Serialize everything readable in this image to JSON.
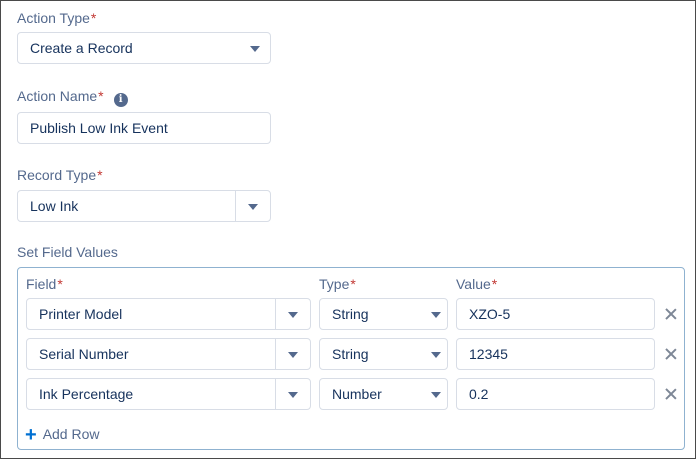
{
  "form": {
    "action_type": {
      "label": "Action Type",
      "required_mark": "*",
      "value": "Create a Record"
    },
    "action_name": {
      "label": "Action Name",
      "required_mark": "*",
      "info_icon": "i",
      "value": "Publish Low Ink Event"
    },
    "record_type": {
      "label": "Record Type",
      "required_mark": "*",
      "value": "Low Ink"
    },
    "set_field_values": {
      "label": "Set Field Values",
      "columns": {
        "field": "Field",
        "type": "Type",
        "value": "Value",
        "required_mark": "*"
      },
      "rows": [
        {
          "field": "Printer Model",
          "type": "String",
          "value": "XZO-5"
        },
        {
          "field": "Serial Number",
          "type": "String",
          "value": "12345"
        },
        {
          "field": "Ink Percentage",
          "type": "Number",
          "value": "0.2"
        }
      ],
      "add_row_icon": "+",
      "add_row_label": "Add Row"
    }
  },
  "colors": {
    "label": "#54698d",
    "required": "#c23934",
    "border": "#d8dde6",
    "group_border": "#8fb2d0",
    "accent": "#0070d2"
  },
  "icons": [
    "chevron-down-icon",
    "info-icon",
    "close-icon",
    "plus-icon"
  ]
}
